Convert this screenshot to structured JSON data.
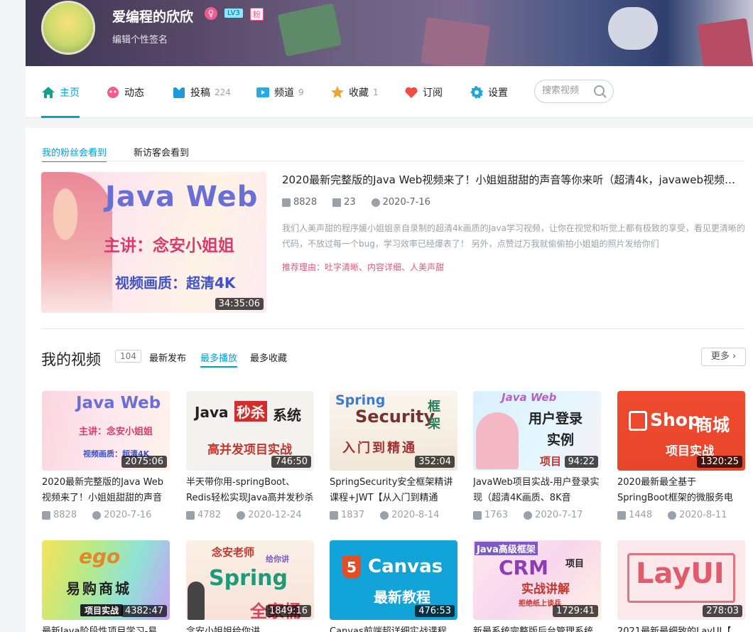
{
  "user": {
    "name": "爱编程的欣欣",
    "gender_symbol": "♀",
    "level": "LV3",
    "fan_badge": "粉",
    "signature": "编辑个性签名"
  },
  "nav": {
    "items": [
      {
        "label": "主页",
        "count": "",
        "icon": "home-icon",
        "active": true
      },
      {
        "label": "动态",
        "count": "",
        "icon": "dynamic-icon"
      },
      {
        "label": "投稿",
        "count": "224",
        "icon": "upload-icon"
      },
      {
        "label": "频道",
        "count": "9",
        "icon": "channel-icon"
      },
      {
        "label": "收藏",
        "count": "1",
        "icon": "star-icon"
      },
      {
        "label": "订阅",
        "count": "",
        "icon": "heart-icon"
      },
      {
        "label": "设置",
        "count": "",
        "icon": "gear-icon"
      }
    ],
    "search_placeholder": "搜索视频"
  },
  "recommend": {
    "tabs": [
      "我的粉丝会看到",
      "新访客会看到"
    ],
    "cover": {
      "line1": "Java Web",
      "line2": "主讲：念安小姐姐",
      "line3": "视频画质：超清4K",
      "duration": "34:35:06"
    },
    "title": "2020最新完整版的Java Web视频来了！小姐姐甜甜的声音等你来听（超清4k，javaweb视频来了）",
    "plays": "8828",
    "danmaku": "23",
    "date": "2020-7-16",
    "desc": "我们人美声甜的程序媛小姐姐亲自录制的超清4k画质的Java学习视频，让你在视觉和听觉上都有极致的享受，看见更清晰的代码，不放过每一个bug，学习效率已经爆表了！ 另外，点赞过万我就偷偷拍小姐姐的照片发给你们",
    "reason": "推荐理由：吐字清晰、内容详细、人美声甜"
  },
  "videos": {
    "title": "我的视频",
    "count": "104",
    "sorts": [
      "最新发布",
      "最多播放",
      "最多收藏"
    ],
    "more": "更多",
    "list": [
      {
        "cover": [
          "Java Web",
          "主讲：念安小姐姐",
          "视频画质：超清4K"
        ],
        "duration": "2075:06",
        "title": "2020最新完整版的Java Web视频来了！小姐姐甜甜的声音",
        "plays": "8828",
        "date": "2020-7-16"
      },
      {
        "cover": [
          "Java",
          "秒杀",
          "系统",
          "高并发项目实战"
        ],
        "duration": "746:50",
        "title": "半天带你用-springBoot、Redis轻松实现Java高并发秒杀",
        "plays": "4782",
        "date": "2020-12-24"
      },
      {
        "cover": [
          "Spring",
          "Security",
          "框",
          "架",
          "入门到精通"
        ],
        "duration": "352:04",
        "title": "SpringSecurity安全框架精讲课程+JWT【从入门到精通",
        "plays": "1837",
        "date": "2020-8-14"
      },
      {
        "cover": [
          "Java Web",
          "用户登录",
          "实例",
          "项目"
        ],
        "duration": "94:22",
        "title": "JavaWeb项目实战-用户登录实现（超清4K画质、8K音",
        "plays": "1763",
        "date": "2020-7-17"
      },
      {
        "cover": [
          "Shop",
          "商城",
          "项目实战"
        ],
        "duration": "1320:25",
        "title": "2020最新最全基于SpringBoot框架的微服务电",
        "plays": "1448",
        "date": "2020-8-11"
      },
      {
        "cover": [
          "ego",
          "易购商城",
          "项目实战"
        ],
        "duration": "4382:47",
        "title": "最新Java阶段性项目学习-易",
        "plays": "",
        "date": ""
      },
      {
        "cover": [
          "念安老师",
          "给你讲",
          "Spring",
          "全家桶"
        ],
        "duration": "1849:16",
        "title": "念安小姐姐给你讲",
        "plays": "",
        "date": ""
      },
      {
        "cover": [
          "5",
          "Canvas",
          "最新教程"
        ],
        "duration": "476:53",
        "title": "Canvas前端超详细实战课程",
        "plays": "",
        "date": ""
      },
      {
        "cover": [
          "Java高级框架",
          "CRM",
          "项目",
          "实战讲解",
          "拒绝纸上谈兵"
        ],
        "duration": "1729:41",
        "title": "新最系统完整版后台管理系统",
        "plays": "",
        "date": ""
      },
      {
        "cover": [
          "LayUI"
        ],
        "duration": "278:03",
        "title": "2021最新最细致的LayUI【",
        "plays": "",
        "date": ""
      }
    ]
  }
}
